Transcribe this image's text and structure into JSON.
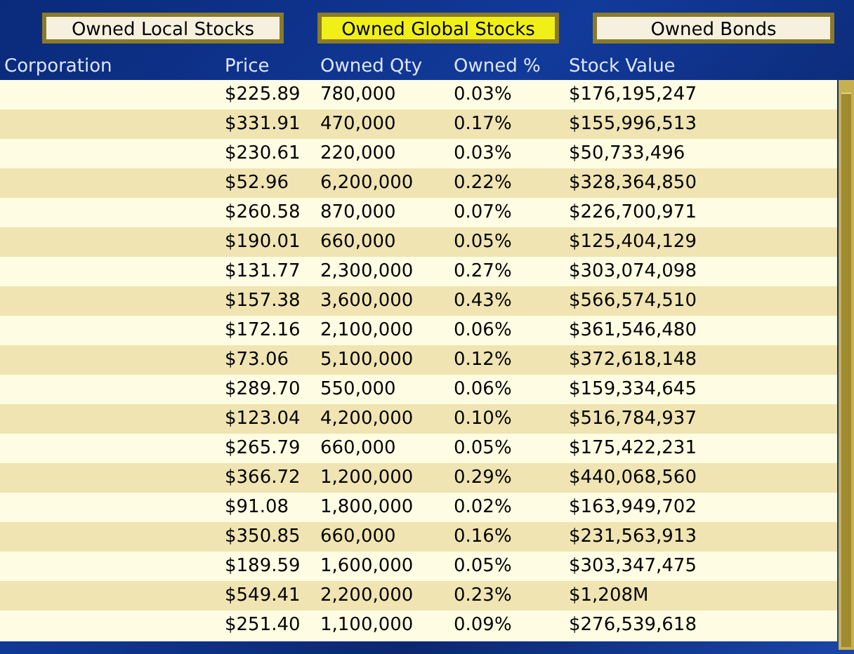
{
  "tabs": [
    {
      "label": "Owned Local Stocks",
      "selected": false
    },
    {
      "label": "Owned Global Stocks",
      "selected": true
    },
    {
      "label": "Owned Bonds",
      "selected": false
    }
  ],
  "table": {
    "columns": [
      "Corporation",
      "Price",
      "Owned Qty",
      "Owned %",
      "Stock Value"
    ],
    "rows": [
      [
        "",
        "$225.89",
        "780,000",
        "0.03%",
        "$176,195,247"
      ],
      [
        "",
        "$331.91",
        "470,000",
        "0.17%",
        "$155,996,513"
      ],
      [
        "",
        "$230.61",
        "220,000",
        "0.03%",
        "$50,733,496"
      ],
      [
        "",
        "$52.96",
        "6,200,000",
        "0.22%",
        "$328,364,850"
      ],
      [
        "",
        "$260.58",
        "870,000",
        "0.07%",
        "$226,700,971"
      ],
      [
        "",
        "$190.01",
        "660,000",
        "0.05%",
        "$125,404,129"
      ],
      [
        "",
        "$131.77",
        "2,300,000",
        "0.27%",
        "$303,074,098"
      ],
      [
        "",
        "$157.38",
        "3,600,000",
        "0.43%",
        "$566,574,510"
      ],
      [
        "",
        "$172.16",
        "2,100,000",
        "0.06%",
        "$361,546,480"
      ],
      [
        "",
        "$73.06",
        "5,100,000",
        "0.12%",
        "$372,618,148"
      ],
      [
        "",
        "$289.70",
        "550,000",
        "0.06%",
        "$159,334,645"
      ],
      [
        "",
        "$123.04",
        "4,200,000",
        "0.10%",
        "$516,784,937"
      ],
      [
        "",
        "$265.79",
        "660,000",
        "0.05%",
        "$175,422,231"
      ],
      [
        "",
        "$366.72",
        "1,200,000",
        "0.29%",
        "$440,068,560"
      ],
      [
        "",
        "$91.08",
        "1,800,000",
        "0.02%",
        "$163,949,702"
      ],
      [
        "",
        "$350.85",
        "660,000",
        "0.16%",
        "$231,563,913"
      ],
      [
        "",
        "$189.59",
        "1,600,000",
        "0.05%",
        "$303,347,475"
      ],
      [
        "",
        "$549.41",
        "2,200,000",
        "0.23%",
        "$1,208M"
      ],
      [
        "",
        "$251.40",
        "1,100,000",
        "0.09%",
        "$276,539,618"
      ]
    ]
  }
}
